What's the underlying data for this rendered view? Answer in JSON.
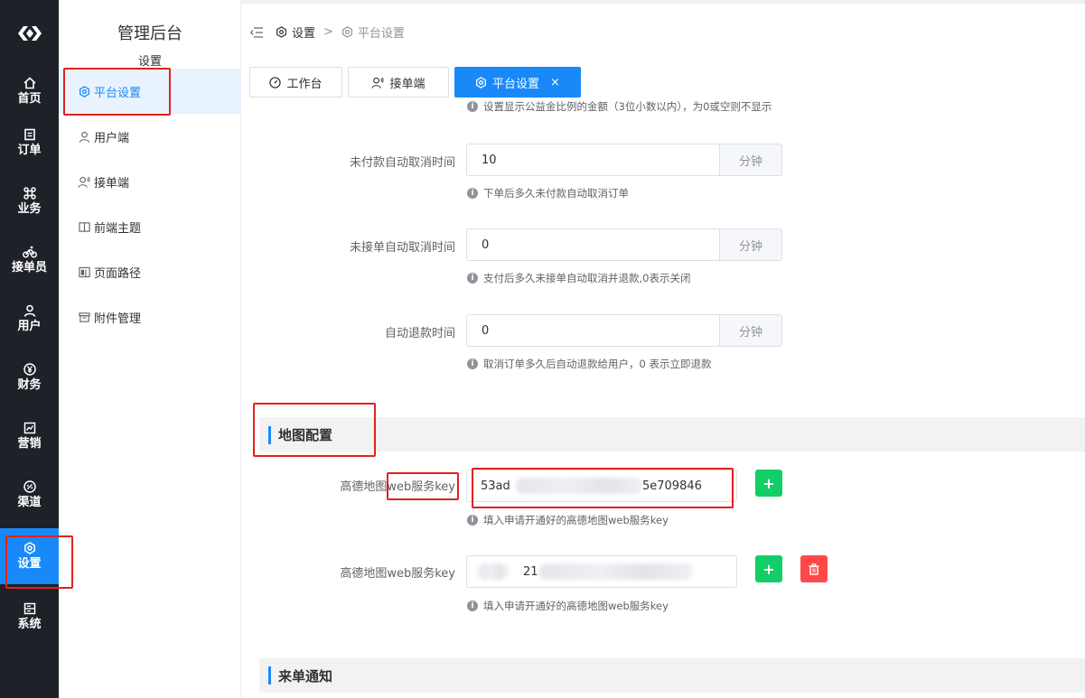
{
  "rail": {
    "items": [
      {
        "label": "首页",
        "icon": "home-icon"
      },
      {
        "label": "订单",
        "icon": "order-icon"
      },
      {
        "label": "业务",
        "icon": "command-icon"
      },
      {
        "label": "接单员",
        "icon": "bike-icon"
      },
      {
        "label": "用户",
        "icon": "user-icon"
      },
      {
        "label": "财务",
        "icon": "yuan-icon"
      },
      {
        "label": "营销",
        "icon": "chart-icon"
      },
      {
        "label": "渠道",
        "icon": "link-icon"
      },
      {
        "label": "设置",
        "icon": "settings-icon"
      },
      {
        "label": "系统",
        "icon": "system-icon"
      }
    ],
    "active_index": 8,
    "accent": "#1989fa"
  },
  "submenu": {
    "title": "管理后台",
    "subtitle": "设置",
    "items": [
      {
        "label": "平台设置",
        "icon": "settings-icon"
      },
      {
        "label": "用户端",
        "icon": "user-icon"
      },
      {
        "label": "接单端",
        "icon": "user-signal-icon"
      },
      {
        "label": "前端主题",
        "icon": "book-icon"
      },
      {
        "label": "页面路径",
        "icon": "layout-icon"
      },
      {
        "label": "附件管理",
        "icon": "archive-icon"
      }
    ]
  },
  "breadcrumb": {
    "items": [
      "设置",
      "平台设置"
    ],
    "separator": ">"
  },
  "tabs": [
    {
      "label": "工作台",
      "icon": "dashboard-icon"
    },
    {
      "label": "接单端",
      "icon": "user-signal-icon"
    },
    {
      "label": "平台设置",
      "icon": "settings-icon",
      "close": "×"
    }
  ],
  "form": {
    "top_hint": "设置显示公益金比例的金额（3位小数以内），为0或空则不显示",
    "unpaid_cancel": {
      "label": "未付款自动取消时间",
      "value": "10",
      "unit": "分钟",
      "hint": "下单后多久未付款自动取消订单"
    },
    "unaccepted_cancel": {
      "label": "未接单自动取消时间",
      "value": "0",
      "unit": "分钟",
      "hint": "支付后多久未接单自动取消并退款,0表示关闭"
    },
    "auto_refund": {
      "label": "自动退款时间",
      "value": "0",
      "unit": "分钟",
      "hint": "取消订单多久后自动退款给用户，0 表示立即退款"
    }
  },
  "map_section": {
    "title": "地图配置",
    "keys": [
      {
        "label_prefix": "高德地图",
        "label_suffix": "web服务key",
        "value_start": "53ad",
        "value_end": "5e709846",
        "hint": "填入申请开通好的高德地图web服务key"
      },
      {
        "label_prefix": "高德地图",
        "label_suffix": "web服务key",
        "value_fragment": "21",
        "hint": "填入申请开通好的高德地图web服务key"
      }
    ],
    "add_label": "+",
    "delete_icon": "trash-icon"
  },
  "notify_section": {
    "title": "来单通知"
  }
}
